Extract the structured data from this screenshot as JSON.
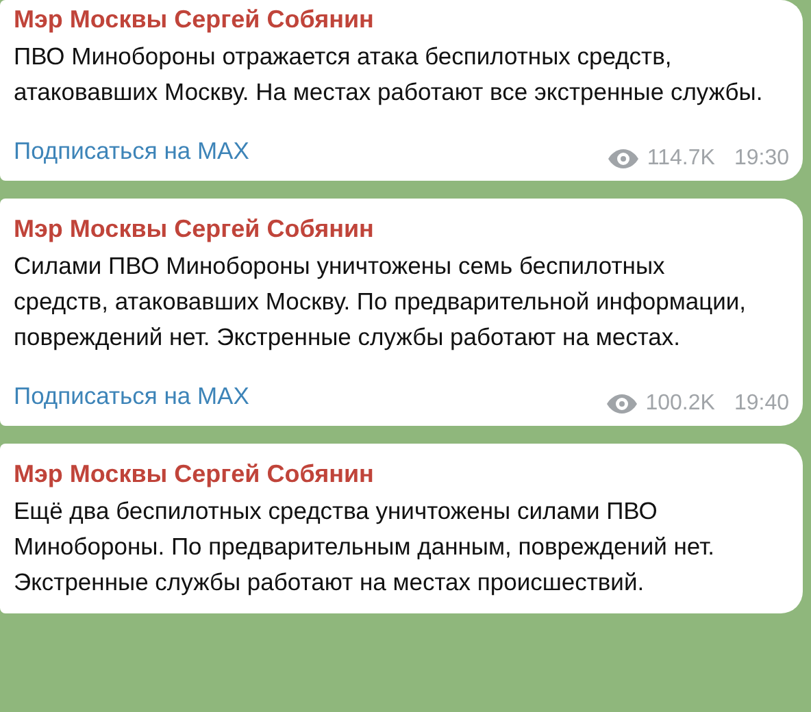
{
  "messages": [
    {
      "author": "Мэр Москвы Сергей Собянин",
      "text": "ПВО Минобороны отражается атака беспилотных средств, атаковавших Москву. На местах работают все экстренные службы.",
      "link": "Подписаться на МАХ",
      "views": "114.7K",
      "time": "19:30"
    },
    {
      "author": "Мэр Москвы Сергей Собянин",
      "text": "Силами ПВО Минобороны уничтожены семь беспилотных средств, атаковавших Москву. По предварительной информации, повреждений нет. Экстренные службы работают на местах.",
      "link": "Подписаться на МАХ",
      "views": "100.2K",
      "time": "19:40"
    },
    {
      "author": "Мэр Москвы Сергей Собянин",
      "text": "Ещё два беспилотных средства уничтожены силами ПВО Минобороны. По предварительным данным, повреждений нет. Экстренные службы работают на местах происшествий."
    }
  ]
}
